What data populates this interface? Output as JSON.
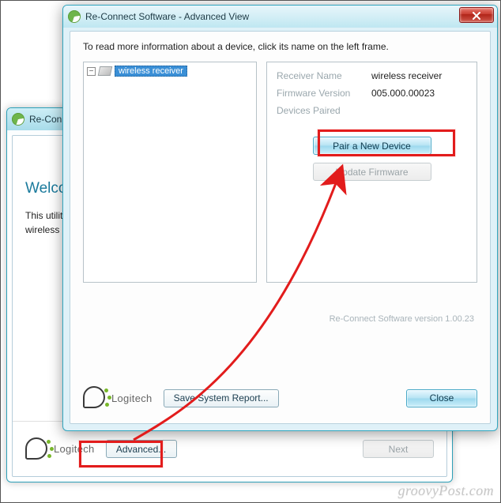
{
  "front": {
    "title": "Re-Connect Software - Advanced View",
    "instruction": "To read more information about a device, click its name on the left frame.",
    "tree": {
      "root_label": "wireless receiver",
      "expand_symbol": "−"
    },
    "info": {
      "receiver_name_label": "Receiver Name",
      "receiver_name_value": "wireless receiver",
      "firmware_label": "Firmware Version",
      "firmware_value": "005.000.00023",
      "devices_paired_label": "Devices Paired"
    },
    "buttons": {
      "pair": "Pair a New Device",
      "update_fw": "Update Firmware",
      "save_report": "Save System Report...",
      "close": "Close"
    },
    "version_text": "Re-Connect Software version 1.00.23",
    "brand": "Logitech"
  },
  "back": {
    "title_prefix": "Re-Conn",
    "heading_prefix": "Welco",
    "desc_line1": "This utility",
    "desc_line2": "wireless d",
    "buttons": {
      "advanced": "Advanced...",
      "next": "Next"
    },
    "brand": "Logitech"
  },
  "annotation": {
    "watermark": "groovyPost.com"
  }
}
